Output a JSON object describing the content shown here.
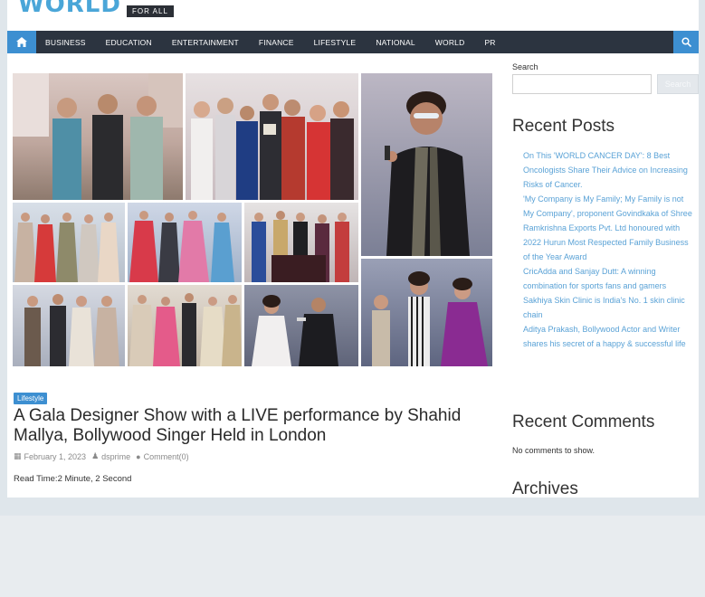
{
  "header": {
    "logo_text": "WORLD",
    "logo_tagline": "FOR ALL"
  },
  "nav": {
    "items": [
      "BUSINESS",
      "EDUCATION",
      "ENTERTAINMENT",
      "FINANCE",
      "LIFESTYLE",
      "NATIONAL",
      "WORLD",
      "PR"
    ]
  },
  "post": {
    "category": "Lifestyle",
    "title": "A Gala Designer Show with a LIVE performance by Shahid Mallya, Bollywood Singer Held in London",
    "date": "February 1, 2023",
    "author": "dsprime",
    "comments": "Comment(0)",
    "read_time": "Read Time:2 Minute, 2 Second"
  },
  "sidebar": {
    "search_label": "Search",
    "search_placeholder": "",
    "search_button": "Search",
    "recent_posts_title": "Recent Posts",
    "recent_posts": [
      "On This 'WORLD CANCER DAY': 8 Best Oncologists Share Their Advice on Increasing Risks of Cancer.",
      "'My Company is My Family; My Family is not My Company', proponent Govindkaka of Shree Ramkrishna Exports Pvt. Ltd honoured with 2022 Hurun Most Respected Family Business of the Year Award",
      "CricAdda and Sanjay Dutt: A winning combination for sports fans and gamers",
      "Sakhiya Skin Clinic is India's No. 1 skin clinic chain",
      "Aditya Prakash, Bollywood Actor and Writer shares his secret of a happy & successful life"
    ],
    "recent_comments_title": "Recent Comments",
    "no_comments": "No comments to show.",
    "archives_title": "Archives"
  },
  "colors": {
    "nav_bg": "#2c3440",
    "accent": "#3d8fd1",
    "link": "#5aa2d6"
  }
}
